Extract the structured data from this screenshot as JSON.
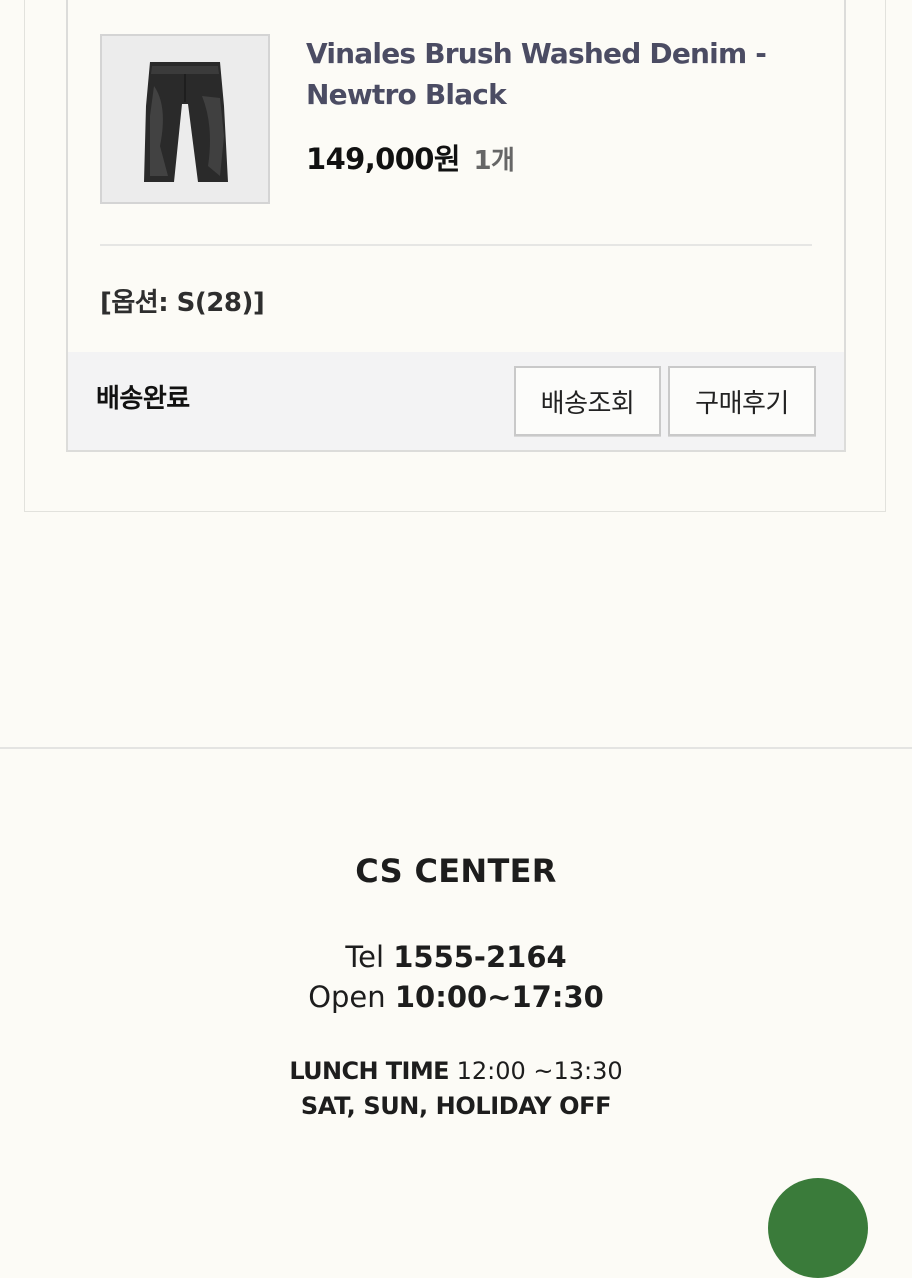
{
  "order": {
    "product_name": "Vinales Brush Washed Denim - Newtro Black",
    "price": "149,000원",
    "quantity": "1개",
    "option": "[옵션: S(28)]",
    "status": "배송완료",
    "buttons": {
      "track_label": "배송조회",
      "review_label": "구매후기"
    }
  },
  "footer": {
    "cs_title": "CS CENTER",
    "tel_label": "Tel",
    "tel_value": "1555-2164",
    "open_label": "Open",
    "open_value": "10:00~17:30",
    "lunch_label": "LUNCH TIME",
    "lunch_value": "12:00 ~13:30",
    "off_text": "SAT, SUN, HOLIDAY OFF"
  },
  "colors": {
    "background": "#fcfbf6",
    "product_name": "#4b4c63",
    "status_bar": "#f3f3f4",
    "floating_button": "#3a7b3a"
  },
  "icons": {
    "floating_button": "chat-icon"
  }
}
